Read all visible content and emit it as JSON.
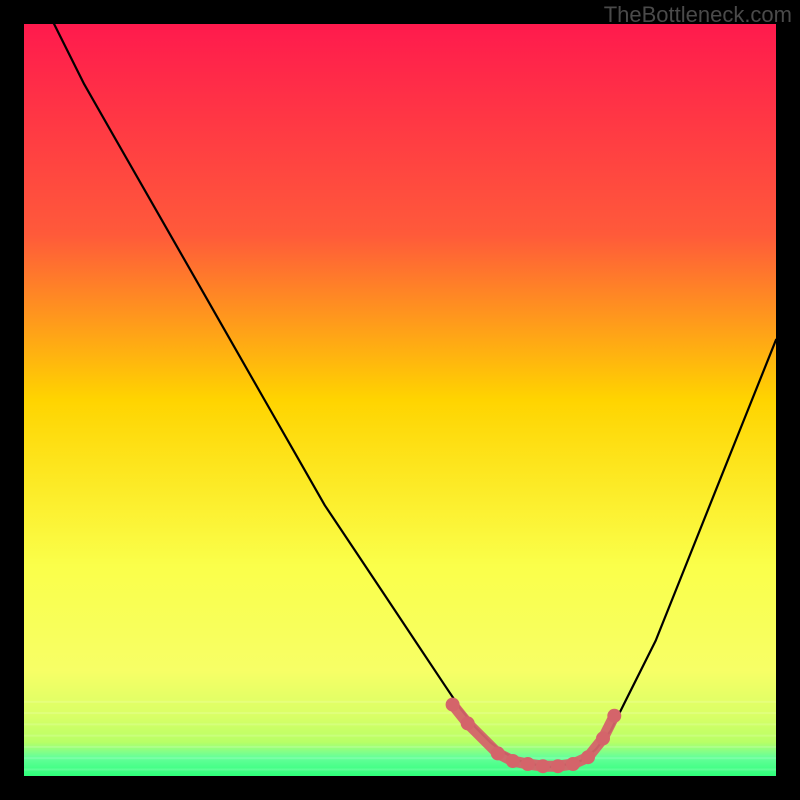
{
  "watermark": "TheBottleneck.com",
  "colors": {
    "frame": "#000000",
    "grad_top": "#ff1a4d",
    "grad_mid1": "#ff6a2a",
    "grad_mid2": "#ffd400",
    "grad_low": "#f7ff66",
    "grad_bottom1": "#b8ff66",
    "grad_bottom2": "#2eff7a",
    "curve": "#000000",
    "marker": "#d4646a"
  },
  "chart_data": {
    "type": "line",
    "title": "",
    "xlabel": "",
    "ylabel": "",
    "xlim": [
      0,
      100
    ],
    "ylim": [
      0,
      100
    ],
    "series": [
      {
        "name": "curve",
        "x": [
          0,
          4,
          8,
          12,
          16,
          20,
          24,
          28,
          32,
          36,
          40,
          44,
          48,
          52,
          56,
          58,
          60,
          62,
          64,
          66,
          68,
          70,
          72,
          74,
          76,
          78,
          80,
          84,
          88,
          92,
          96,
          100
        ],
        "values": [
          112,
          100,
          92,
          85,
          78,
          71,
          64,
          57,
          50,
          43,
          36,
          30,
          24,
          18,
          12,
          9,
          6.5,
          4.5,
          3,
          2,
          1.5,
          1.2,
          1.5,
          2,
          3.5,
          6,
          10,
          18,
          28,
          38,
          48,
          58
        ]
      }
    ],
    "markers": [
      {
        "x": 57,
        "y": 9.5
      },
      {
        "x": 59,
        "y": 7
      },
      {
        "x": 63,
        "y": 3
      },
      {
        "x": 65,
        "y": 2
      },
      {
        "x": 67,
        "y": 1.6
      },
      {
        "x": 69,
        "y": 1.3
      },
      {
        "x": 71,
        "y": 1.3
      },
      {
        "x": 73,
        "y": 1.6
      },
      {
        "x": 75,
        "y": 2.5
      },
      {
        "x": 77,
        "y": 5
      },
      {
        "x": 78.5,
        "y": 8
      }
    ]
  }
}
